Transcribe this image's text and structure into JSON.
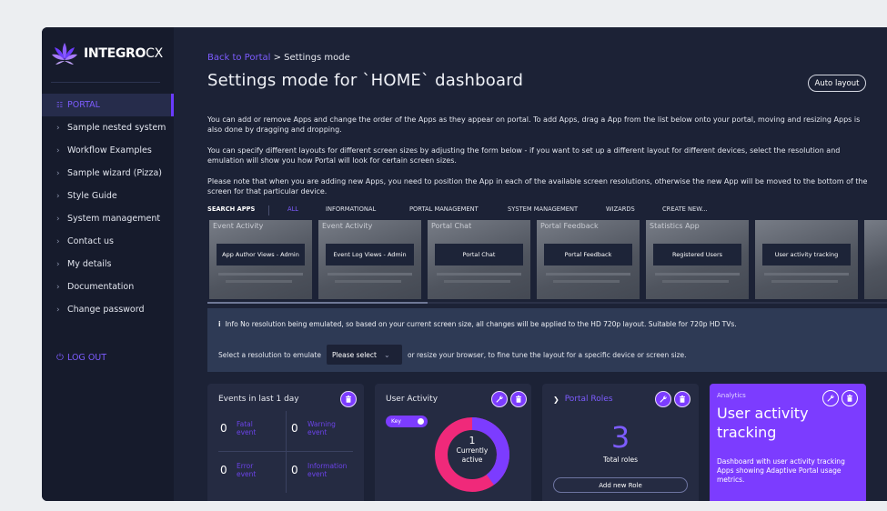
{
  "brand": {
    "name_bold": "INTEGRO",
    "name_light": "CX"
  },
  "sidebar": {
    "items": [
      {
        "label": "PORTAL",
        "active": true
      },
      {
        "label": "Sample nested system"
      },
      {
        "label": "Workflow Examples"
      },
      {
        "label": "Sample wizard (Pizza)"
      },
      {
        "label": "Style Guide"
      },
      {
        "label": "System management"
      },
      {
        "label": "Contact us"
      },
      {
        "label": "My details"
      },
      {
        "label": "Documentation"
      },
      {
        "label": "Change password"
      }
    ],
    "logout": "LOG OUT"
  },
  "header": {
    "breadcrumb_link": "Back to Portal",
    "breadcrumb_sep": ">",
    "breadcrumb_current": "Settings mode",
    "title": "Settings mode for `HOME` dashboard",
    "auto_layout": "Auto layout"
  },
  "paragraphs": [
    "You can add or remove Apps and change the order of the Apps as they appear on portal. To add Apps, drag a App from the list below onto your portal, moving and resizing Apps is also done by dragging and dropping.",
    "You can specify different layouts for different screen sizes by adjusting the form below - if you want to set up a different layout for different devices, select the resolution and emulation will show you how Portal will look for certain screen sizes.",
    "Please note that when you are adding new Apps, you need to position the App in each of the available screen resolutions, otherwise the new App will be moved to the bottom of the screen for that particular device."
  ],
  "tabs": {
    "search": "SEARCH APPS",
    "items": [
      "ALL",
      "INFORMATIONAL",
      "PORTAL MANAGEMENT",
      "SYSTEM MANAGEMENT",
      "WIZARDS",
      "CREATE NEW..."
    ]
  },
  "apps": [
    {
      "preview": "Event Activity",
      "label": "App Author Views - Admin"
    },
    {
      "preview": "Event Activity",
      "label": "Event Log Views - Admin"
    },
    {
      "preview": "Portal Chat",
      "label": "Portal Chat"
    },
    {
      "preview": "Portal Feedback",
      "label": "Portal Feedback"
    },
    {
      "preview": "Statistics App",
      "label": "Registered Users"
    },
    {
      "preview": "",
      "label": "User activity tracking"
    }
  ],
  "info": {
    "icon": "i",
    "text": "Info No resolution being emulated, so based on your current screen size, all changes will be applied to the HD 720p layout. Suitable for 720p HD TVs.",
    "emulate_prefix": "Select a resolution to emulate",
    "select_value": "Please select",
    "emulate_suffix": "or resize your browser, to fine tune the layout for a specific device or screen size."
  },
  "events": {
    "title": "Events in last 1 day",
    "cells": [
      {
        "count": "0",
        "label_1": "Fatal",
        "label_2": "event"
      },
      {
        "count": "0",
        "label_1": "Warning",
        "label_2": "event"
      },
      {
        "count": "0",
        "label_1": "Error",
        "label_2": "event"
      },
      {
        "count": "0",
        "label_1": "Information",
        "label_2": "event"
      }
    ]
  },
  "user_activity": {
    "title": "User Activity",
    "key_label": "Key",
    "count": "1",
    "caption_1": "Currently",
    "caption_2": "active",
    "active_fraction": 0.4,
    "colors": {
      "active": "#7c3cff",
      "inactive": "#f0297a"
    }
  },
  "roles": {
    "title": "Portal Roles",
    "count": "3",
    "caption": "Total roles",
    "add_button": "Add new Role"
  },
  "analytics": {
    "category": "Analytics",
    "title": "User activity tracking",
    "description": "Dashboard with user activity tracking Apps showing Adaptive Portal usage metrics."
  },
  "colors": {
    "accent": "#7c3cff",
    "link": "#7d5cff",
    "background": "#1c2236",
    "sidebar": "#161b2c"
  }
}
